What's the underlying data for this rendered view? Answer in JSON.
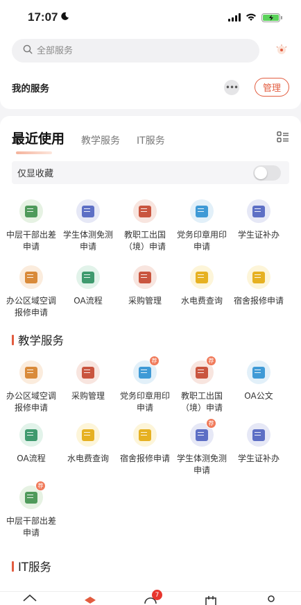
{
  "status_bar": {
    "time": "17:07",
    "moon_icon": "moon-icon",
    "signal_icon": "signal-icon",
    "wifi_icon": "wifi-icon",
    "battery_icon": "battery-charging-icon",
    "battery_color": "#5ad25a"
  },
  "search": {
    "placeholder": "全部服务",
    "icon": "search-icon"
  },
  "my_services": {
    "title": "我的服务",
    "more_icon": "more-dots-icon",
    "manage_label": "管理"
  },
  "tabs": [
    {
      "label": "最近使用",
      "active": true
    },
    {
      "label": "教学服务",
      "active": false
    },
    {
      "label": "IT服务",
      "active": false
    }
  ],
  "favorites_toggle": {
    "label": "仅显收藏",
    "on": false
  },
  "recent_items": [
    {
      "label": "中层干部出差申请",
      "icon": "form-icon",
      "color": "#4f9a5b",
      "bg": "#e6f2e3",
      "badge": false
    },
    {
      "label": "学生体测免测申请",
      "icon": "document-icon",
      "color": "#5d6fc5",
      "bg": "#e6e8f6",
      "badge": false
    },
    {
      "label": "教职工出国（境）申请",
      "icon": "plane-doc-icon",
      "color": "#c9553f",
      "bg": "#f8e5df",
      "badge": false
    },
    {
      "label": "党务印章用印申请",
      "icon": "stamp-doc-icon",
      "color": "#3f9ad6",
      "bg": "#e2f0f9",
      "badge": false
    },
    {
      "label": "学生证补办",
      "icon": "id-card-icon",
      "color": "#5d6fc5",
      "bg": "#e6e8f6",
      "badge": false
    },
    {
      "label": "办公区域空调报修申请",
      "icon": "edit-doc-icon",
      "color": "#d98a3a",
      "bg": "#fbecdd",
      "badge": false
    },
    {
      "label": "OA流程",
      "icon": "search-doc-icon",
      "color": "#3f9a6e",
      "bg": "#e2f3ea",
      "badge": false
    },
    {
      "label": "采购管理",
      "icon": "purchase-doc-icon",
      "color": "#c9553f",
      "bg": "#f8e5df",
      "badge": false
    },
    {
      "label": "水电费查询",
      "icon": "lightning-icon",
      "color": "#e6b122",
      "bg": "#fdf5d9",
      "badge": false
    },
    {
      "label": "宿舍报修申请",
      "icon": "building-icon",
      "color": "#e6b122",
      "bg": "#fdf5d9",
      "badge": false
    }
  ],
  "teaching_section": {
    "title": "教学服务"
  },
  "teaching_items": [
    {
      "label": "办公区域空调报修申请",
      "icon": "edit-doc-icon",
      "color": "#d98a3a",
      "bg": "#fbecdd",
      "badge": false
    },
    {
      "label": "采购管理",
      "icon": "purchase-doc-icon",
      "color": "#c9553f",
      "bg": "#f8e5df",
      "badge": false
    },
    {
      "label": "党务印章用印申请",
      "icon": "stamp-doc-icon",
      "color": "#3f9ad6",
      "bg": "#e2f0f9",
      "badge": true,
      "badge_text": "荐"
    },
    {
      "label": "教职工出国（境）申请",
      "icon": "plane-doc-icon",
      "color": "#c9553f",
      "bg": "#f8e5df",
      "badge": true,
      "badge_text": "荐"
    },
    {
      "label": "OA公文",
      "icon": "document-icon",
      "color": "#3f9ad6",
      "bg": "#e2f0f9",
      "badge": false
    },
    {
      "label": "OA流程",
      "icon": "search-doc-icon",
      "color": "#3f9a6e",
      "bg": "#e2f3ea",
      "badge": false
    },
    {
      "label": "水电费查询",
      "icon": "lightning-icon",
      "color": "#e6b122",
      "bg": "#fdf5d9",
      "badge": false
    },
    {
      "label": "宿舍报修申请",
      "icon": "building-icon",
      "color": "#e6b122",
      "bg": "#fdf5d9",
      "badge": false
    },
    {
      "label": "学生体测免测申请",
      "icon": "document-icon",
      "color": "#5d6fc5",
      "bg": "#e6e8f6",
      "badge": true,
      "badge_text": "荐"
    },
    {
      "label": "学生证补办",
      "icon": "id-card-icon",
      "color": "#5d6fc5",
      "bg": "#e6e8f6",
      "badge": false
    },
    {
      "label": "中层干部出差申请",
      "icon": "form-icon",
      "color": "#4f9a5b",
      "bg": "#e6f2e3",
      "badge": true,
      "badge_text": "荐"
    }
  ],
  "it_section": {
    "title": "IT服务"
  },
  "bottom_tabs": [
    {
      "icon": "home-icon"
    },
    {
      "icon": "services-icon",
      "active": true
    },
    {
      "icon": "messages-icon",
      "badge": "7"
    },
    {
      "icon": "calendar-icon"
    },
    {
      "icon": "profile-icon"
    }
  ],
  "accent_color": "#e25c3f"
}
